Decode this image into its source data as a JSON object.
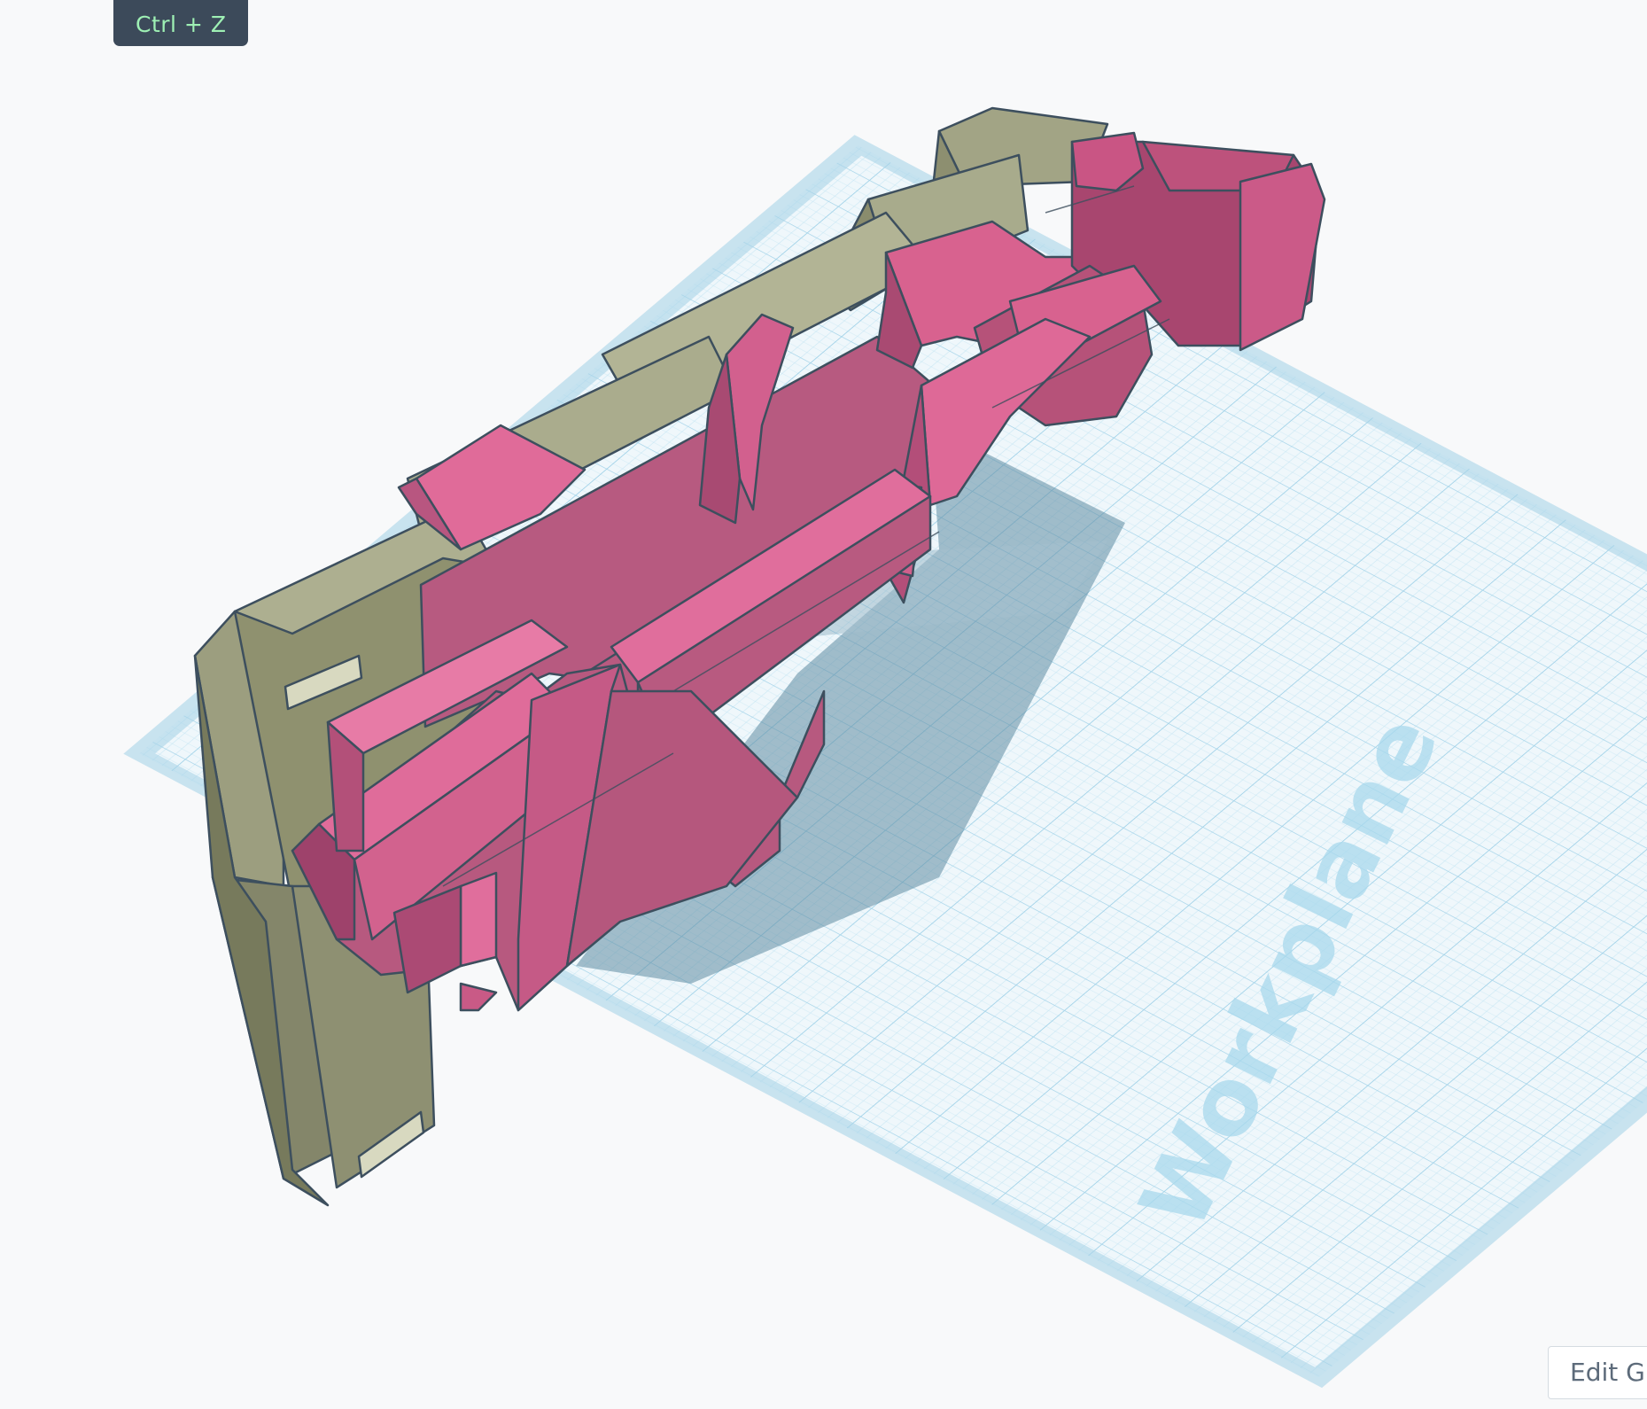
{
  "shortcut_hint": {
    "label": "Ctrl + Z"
  },
  "workplane": {
    "label": "Workplane",
    "grid_color": "#b9e0f0",
    "border_color": "#a9d4e8"
  },
  "edit_grid": {
    "label": "Edit Grid"
  },
  "model": {
    "icon": "3d-blaster-model",
    "primary_color": "#d95d8e",
    "secondary_color": "#9a9a78"
  }
}
